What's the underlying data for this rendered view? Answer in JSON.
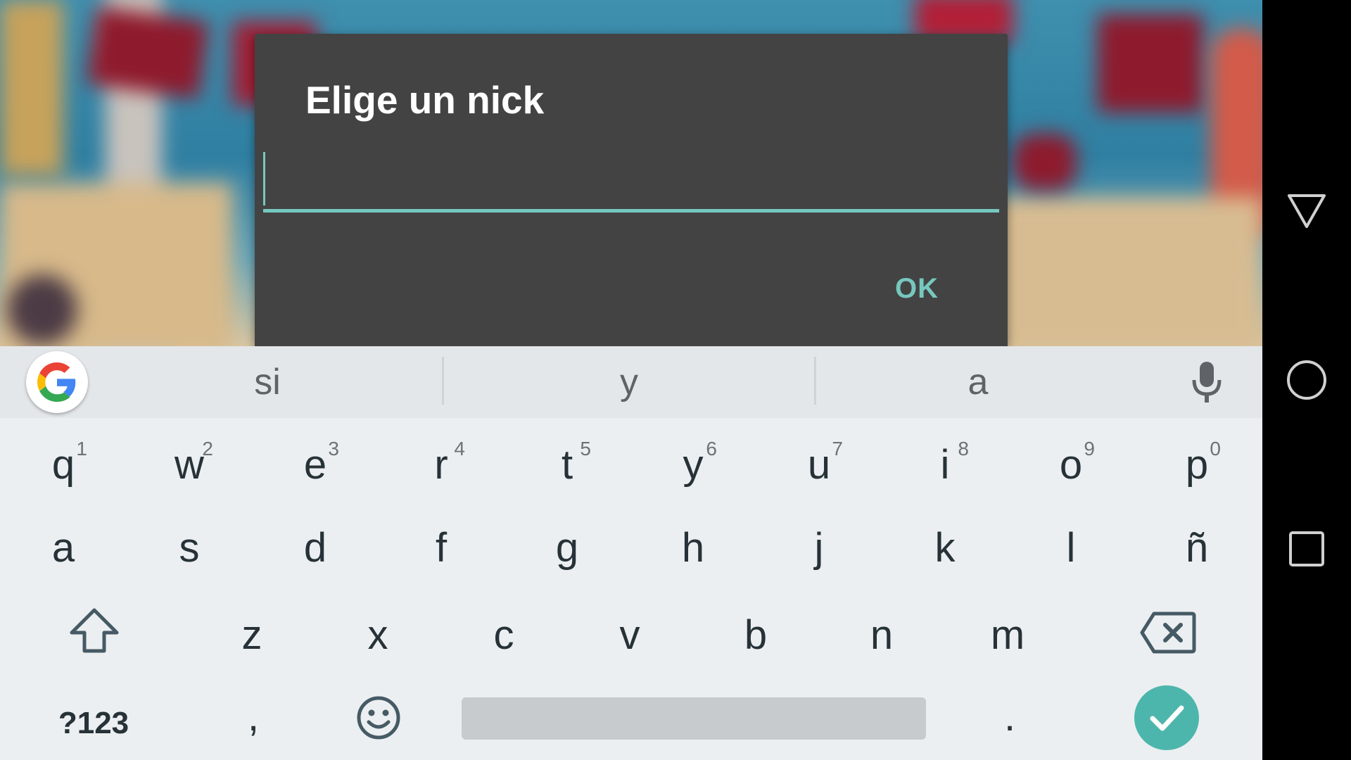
{
  "dialog": {
    "title": "Elige un nick",
    "input_value": "",
    "ok_label": "OK"
  },
  "keyboard": {
    "suggestions": [
      "si",
      "y",
      "a"
    ],
    "row1": [
      {
        "key": "q",
        "hint": "1"
      },
      {
        "key": "w",
        "hint": "2"
      },
      {
        "key": "e",
        "hint": "3"
      },
      {
        "key": "r",
        "hint": "4"
      },
      {
        "key": "t",
        "hint": "5"
      },
      {
        "key": "y",
        "hint": "6"
      },
      {
        "key": "u",
        "hint": "7"
      },
      {
        "key": "i",
        "hint": "8"
      },
      {
        "key": "o",
        "hint": "9"
      },
      {
        "key": "p",
        "hint": "0"
      }
    ],
    "row2": [
      "a",
      "s",
      "d",
      "f",
      "g",
      "h",
      "j",
      "k",
      "l",
      "ñ"
    ],
    "row3": [
      "z",
      "x",
      "c",
      "v",
      "b",
      "n",
      "m"
    ],
    "symbols_label": "?123",
    "comma_label": ",",
    "period_label": "."
  },
  "icons": {
    "google": "google-g-icon",
    "mic": "microphone-icon",
    "shift": "shift-icon",
    "delete": "backspace-icon",
    "emoji": "emoji-icon",
    "enter": "checkmark-icon",
    "back": "nav-back-icon",
    "home": "nav-home-icon",
    "recents": "nav-recents-icon"
  },
  "colors": {
    "accent": "#76c8bf",
    "enter": "#4db6ac",
    "dialog_bg": "#434343",
    "keyboard_bg": "#eceff1"
  }
}
